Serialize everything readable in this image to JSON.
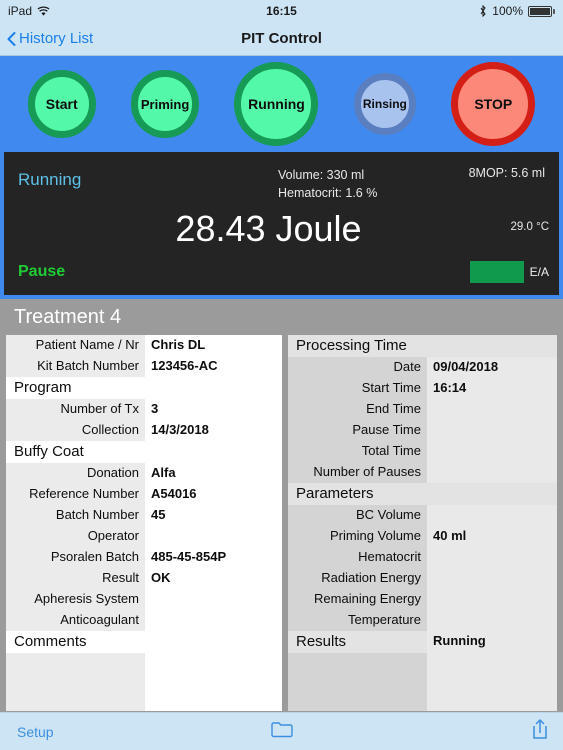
{
  "status_bar": {
    "device": "iPad",
    "wifi_icon": "wifi-icon",
    "time": "16:15",
    "bluetooth_icon": "bluetooth-icon",
    "battery_percent": "100%",
    "battery_icon": "battery-full-icon"
  },
  "nav": {
    "back_icon": "chevron-left-icon",
    "back_label": "History List",
    "title": "PIT Control"
  },
  "states": [
    {
      "label": "Start",
      "name": "state-button-start",
      "active": true
    },
    {
      "label": "Priming",
      "name": "state-button-priming",
      "active": true
    },
    {
      "label": "Running",
      "name": "state-button-running",
      "active": true
    },
    {
      "label": "Rinsing",
      "name": "state-button-rinsing",
      "active": false
    },
    {
      "label": "STOP",
      "name": "state-button-stop",
      "active": false
    }
  ],
  "colors": {
    "strip_blue": "#4089ef",
    "active_green_fill": "#53f9a9",
    "active_green_ring": "#169a55",
    "inactive_blue_fill": "#a9c3ef",
    "inactive_blue_ring": "#5a7fc0",
    "stop_fill": "#fb8878",
    "stop_ring": "#d41f16",
    "panel_dark": "#242424",
    "state_cyan": "#5dc0e8",
    "pause_green": "#1fcc34",
    "ea_green": "#0f9a4e",
    "ios_tint": "#3b8fe0"
  },
  "telemetry": {
    "state": "Running",
    "volume": "Volume: 330 ml",
    "hematocrit": "Hematocrit: 1.6 %",
    "mop": "8MOP: 5.6 ml",
    "energy": "28.43 Joule",
    "temperature": "29.0 °C",
    "pause_label": "Pause",
    "ea_label": "E/A"
  },
  "detail": {
    "title": "Treatment 4",
    "left": {
      "rows_top": [
        {
          "label": "Patient Name / Nr",
          "value": "Chris DL"
        },
        {
          "label": "Kit Batch Number",
          "value": "123456-AC"
        }
      ],
      "program_head": "Program",
      "rows_program": [
        {
          "label": "Number of Tx",
          "value": "3"
        },
        {
          "label": "Collection",
          "value": "14/3/2018"
        }
      ],
      "buffy_head": "Buffy Coat",
      "rows_buffy": [
        {
          "label": "Donation",
          "value": "Alfa"
        },
        {
          "label": "Reference Number",
          "value": "A54016"
        },
        {
          "label": "Batch Number",
          "value": "45"
        },
        {
          "label": "Operator",
          "value": ""
        },
        {
          "label": "Psoralen Batch",
          "value": "485-45-854P"
        },
        {
          "label": "Result",
          "value": "OK"
        },
        {
          "label": "Apheresis System",
          "value": ""
        },
        {
          "label": "Anticoagulant",
          "value": ""
        }
      ],
      "comments_head": "Comments"
    },
    "right": {
      "processing_head": "Processing Time",
      "rows_processing": [
        {
          "label": "Date",
          "value": "09/04/2018"
        },
        {
          "label": "Start Time",
          "value": "16:14"
        },
        {
          "label": "End Time",
          "value": ""
        },
        {
          "label": "Pause Time",
          "value": ""
        },
        {
          "label": "Total Time",
          "value": ""
        },
        {
          "label": "Number of Pauses",
          "value": ""
        }
      ],
      "parameters_head": "Parameters",
      "rows_parameters": [
        {
          "label": "BC Volume",
          "value": ""
        },
        {
          "label": "Priming Volume",
          "value": "40 ml"
        },
        {
          "label": "Hematocrit",
          "value": ""
        },
        {
          "label": "Radiation Energy",
          "value": ""
        },
        {
          "label": "Remaining Energy",
          "value": ""
        },
        {
          "label": "Temperature",
          "value": ""
        }
      ],
      "results_head": "Results",
      "results_value": "Running"
    }
  },
  "toolbar": {
    "setup_label": "Setup",
    "folder_icon": "folder-icon",
    "share_icon": "share-icon"
  }
}
